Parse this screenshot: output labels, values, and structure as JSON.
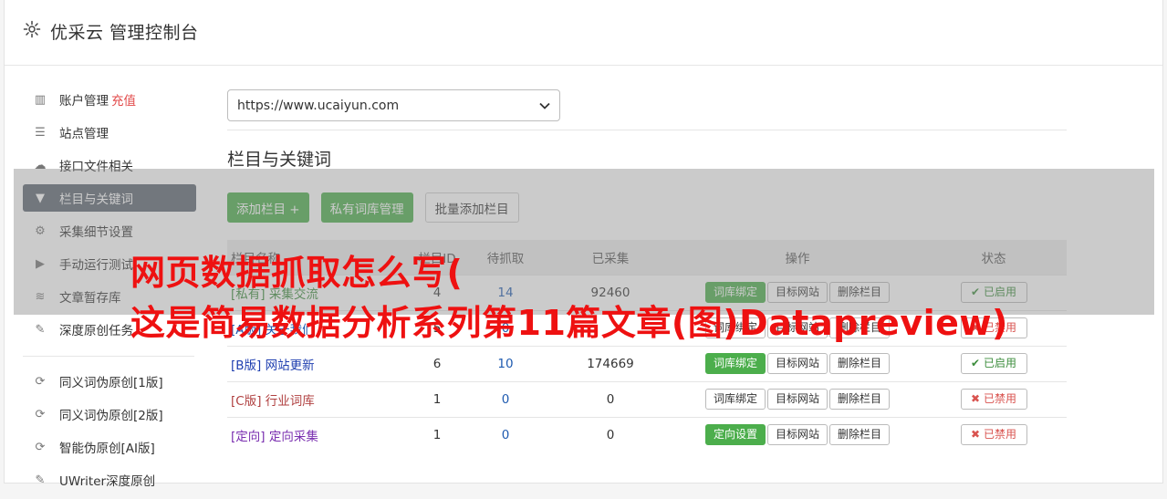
{
  "header": {
    "title": "优采云 管理控制台"
  },
  "sidebar": {
    "items": [
      {
        "label": "账户管理",
        "badge": "充值",
        "icon": "bar-chart-icon"
      },
      {
        "label": "站点管理",
        "icon": "server-icon"
      },
      {
        "label": "接口文件相关",
        "icon": "cloud-upload-icon"
      },
      {
        "label": "栏目与关键词",
        "icon": "filter-icon",
        "active": true
      },
      {
        "label": "采集细节设置",
        "icon": "cogs-icon"
      },
      {
        "label": "手动运行测试",
        "icon": "play-circle-icon"
      },
      {
        "label": "文章暂存库",
        "icon": "database-icon"
      },
      {
        "label": "深度原创任务",
        "icon": "edit-icon"
      },
      {
        "label": "同义词伪原创[1版]",
        "icon": "refresh-icon"
      },
      {
        "label": "同义词伪原创[2版]",
        "icon": "refresh-icon"
      },
      {
        "label": "智能伪原创[AI版]",
        "icon": "refresh-icon"
      },
      {
        "label": "UWriter深度原创",
        "icon": "edit-icon"
      }
    ]
  },
  "site_select": {
    "value": "https://www.ucaiyun.com"
  },
  "section_title": "栏目与关键词",
  "buttons": {
    "add": "添加栏目 +",
    "private": "私有词库管理",
    "batch": "批量添加栏目"
  },
  "table": {
    "headers": [
      "栏目名称",
      "栏目ID",
      "待抓取",
      "已采集",
      "操作",
      "状态"
    ],
    "rows": [
      {
        "tag": "[私有]",
        "name": "采集交流",
        "id": "4",
        "pending": "14",
        "collected": "92460",
        "op1": "词库绑定",
        "op2": "目标网站",
        "op3": "删除栏目",
        "status": "已启用",
        "on": true,
        "color": "#3c8d3c",
        "op1g": true
      },
      {
        "tag": "[A版]",
        "name": "关于我们",
        "id": "5",
        "pending": "0",
        "collected": "",
        "op1": "词库绑定",
        "op2": "目标网站",
        "op3": "删除栏目",
        "status": "已禁用",
        "on": false,
        "color": "#1f5bb0",
        "op1g": false
      },
      {
        "tag": "[B版]",
        "name": "网站更新",
        "id": "6",
        "pending": "10",
        "collected": "174669",
        "op1": "词库绑定",
        "op2": "目标网站",
        "op3": "删除栏目",
        "status": "已启用",
        "on": true,
        "color": "#1f3fb0",
        "op1g": true
      },
      {
        "tag": "[C版]",
        "name": "行业词库",
        "id": "1",
        "pending": "0",
        "collected": "0",
        "op1": "词库绑定",
        "op2": "目标网站",
        "op3": "删除栏目",
        "status": "已禁用",
        "on": false,
        "color": "#b04040",
        "op1g": false
      },
      {
        "tag": "[定向]",
        "name": "定向采集",
        "id": "1",
        "pending": "0",
        "collected": "0",
        "op1": "定向设置",
        "op2": "目标网站",
        "op3": "删除栏目",
        "status": "已禁用",
        "on": false,
        "color": "#7a2fb0",
        "op1g": true
      }
    ]
  },
  "overlay": {
    "line1": "网页数据抓取怎么写(",
    "line2": "这是简易数据分析系列第11篇文章(图)Datapreview)"
  },
  "colors": {
    "green": "#4cae4c",
    "active_nav": "#5e6671",
    "caption": "#ee1111"
  }
}
